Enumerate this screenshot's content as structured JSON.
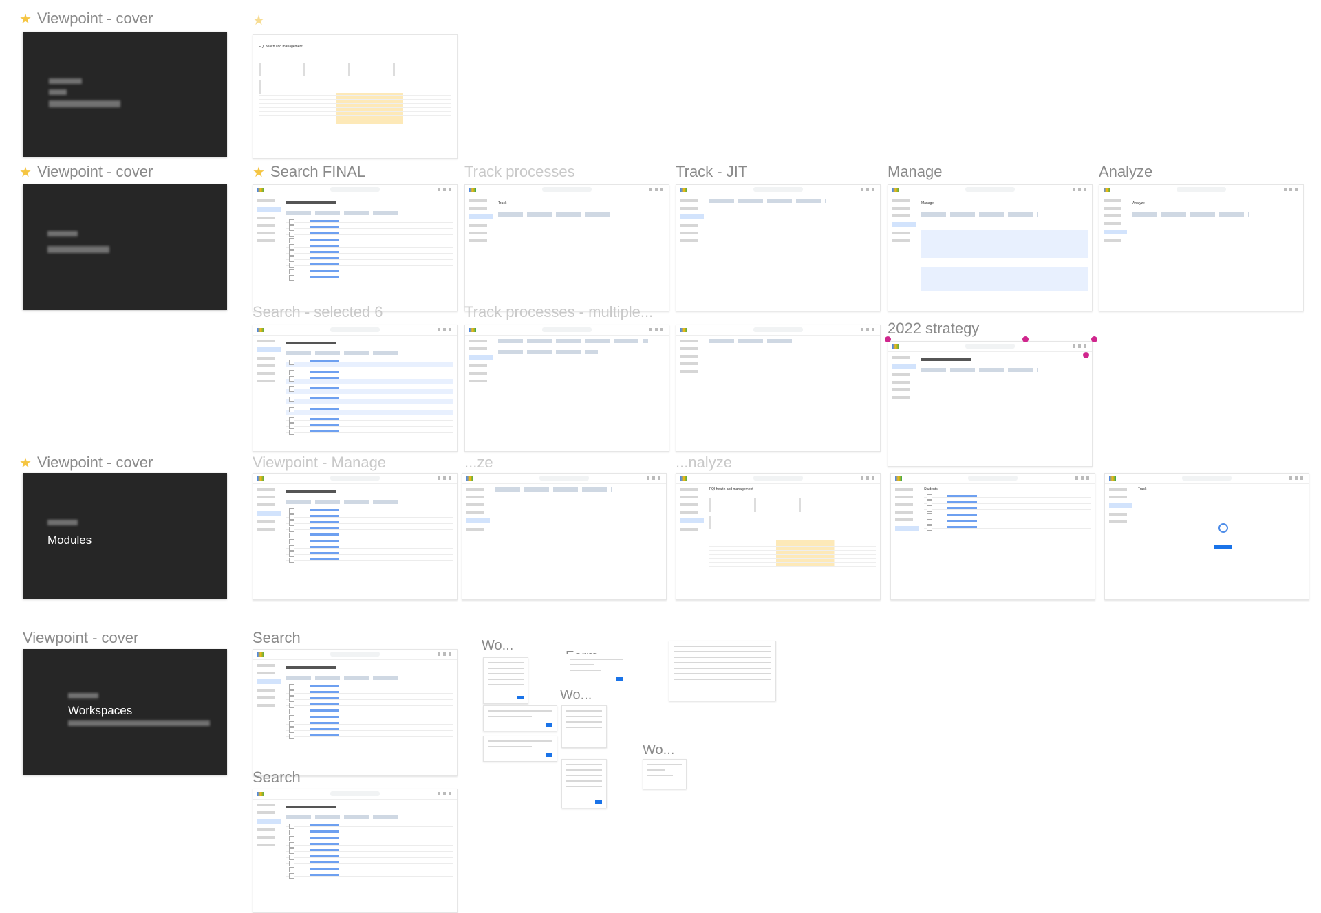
{
  "canvas": {
    "labels": {
      "cover1": "Viewpoint - cover",
      "cover2": "Viewpoint - cover",
      "cover3": "Viewpoint - cover",
      "cover4": "Viewpoint - cover",
      "search_final": "Search FINAL",
      "track_jit": "Track - JIT",
      "manage": "Manage",
      "analyze": "Analyze",
      "strategy_2022": "2022 strategy",
      "search1": "Search",
      "search2": "Search",
      "wo1": "Wo...",
      "wo2": "Wo...",
      "wo3": "Wo...",
      "form": "Form ...",
      "faded_track_processes": "Track processes",
      "faded_search_selected": "Search - selected 6",
      "faded_track_multiple": "Track processes - multiple...",
      "faded_viewpoint_manage": "Viewpoint - Manage",
      "faded_analyze1": "...ze",
      "faded_analyze2": "...nalyze"
    },
    "covers": {
      "cover3_title": "Modules",
      "cover4_title": "Workspaces"
    },
    "frames": {
      "fqi_title": "FQI health and management",
      "search_title": "Search",
      "track_title": "Track",
      "manage_title": "Manage",
      "analyze_title": "Analyze",
      "students_title": "Students",
      "track_empty_title": "Track"
    },
    "kpis": [
      "86%",
      "73%",
      "81%",
      "3.4K",
      "3.4"
    ],
    "pins": [
      "1",
      "2",
      "3",
      "4"
    ]
  }
}
